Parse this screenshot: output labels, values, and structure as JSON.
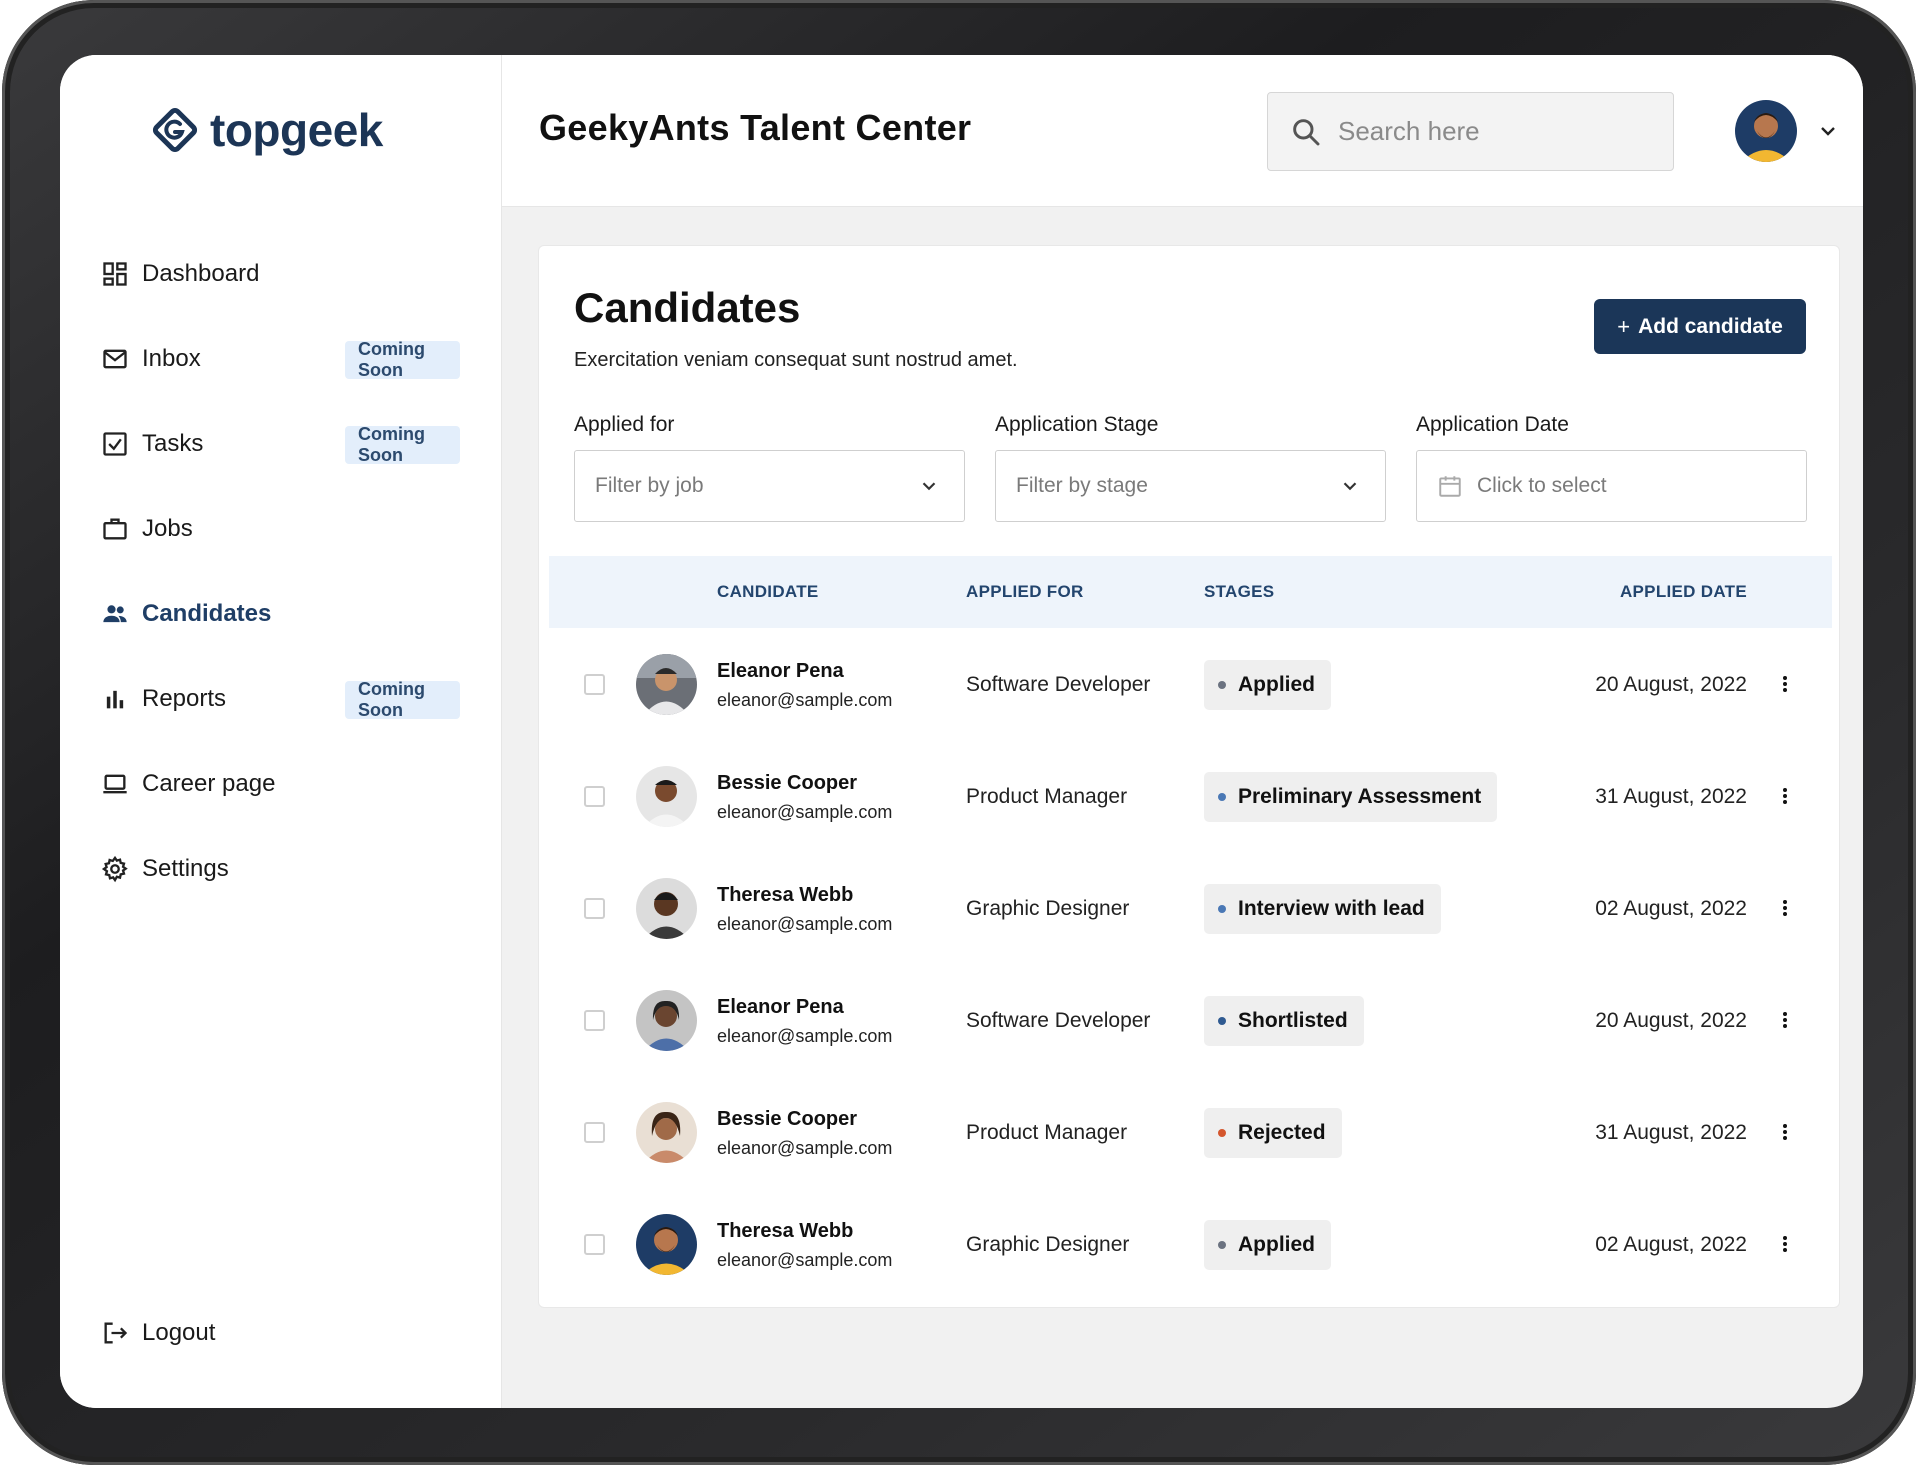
{
  "brand": {
    "name": "topgeek",
    "color": "#1c3556"
  },
  "sidebar": {
    "items": [
      {
        "label": "Dashboard",
        "icon": "dashboard-icon",
        "badge": ""
      },
      {
        "label": "Inbox",
        "icon": "mail-icon",
        "badge": "Coming Soon"
      },
      {
        "label": "Tasks",
        "icon": "checkbox-icon",
        "badge": "Coming Soon"
      },
      {
        "label": "Jobs",
        "icon": "briefcase-icon",
        "badge": ""
      },
      {
        "label": "Candidates",
        "icon": "people-icon",
        "badge": "",
        "active": true
      },
      {
        "label": "Reports",
        "icon": "bar-chart-icon",
        "badge": "Coming Soon"
      },
      {
        "label": "Career page",
        "icon": "laptop-icon",
        "badge": ""
      },
      {
        "label": "Settings",
        "icon": "gear-icon",
        "badge": ""
      }
    ],
    "logout": {
      "label": "Logout",
      "icon": "logout-icon"
    }
  },
  "header": {
    "title": "GeekyAnts Talent Center",
    "search_placeholder": "Search here"
  },
  "page": {
    "title": "Candidates",
    "subtitle": "Exercitation veniam consequat sunt nostrud amet.",
    "add_button": "Add candidate",
    "accent": "#1b3658"
  },
  "filters": [
    {
      "label": "Applied for",
      "placeholder": "Filter by job"
    },
    {
      "label": "Application Stage",
      "placeholder": "Filter by stage"
    },
    {
      "label": "Application Date",
      "placeholder": "Click to select"
    }
  ],
  "table": {
    "headers": [
      "CANDIDATE",
      "APPLIED FOR",
      "STAGES",
      "APPLIED DATE"
    ],
    "rows": [
      {
        "name": "Eleanor Pena",
        "email": "eleanor@sample.com",
        "job": "Software Developer",
        "stage": "Applied",
        "stage_color": "#6b7280",
        "date": "20 August, 2022"
      },
      {
        "name": "Bessie Cooper",
        "email": "eleanor@sample.com",
        "job": "Product Manager",
        "stage": "Preliminary Assessment",
        "stage_color": "#4a78b5",
        "date": "31 August, 2022"
      },
      {
        "name": "Theresa Webb",
        "email": "eleanor@sample.com",
        "job": "Graphic Designer",
        "stage": "Interview with lead",
        "stage_color": "#4a78b5",
        "date": "02 August, 2022"
      },
      {
        "name": "Eleanor Pena",
        "email": "eleanor@sample.com",
        "job": "Software Developer",
        "stage": "Shortlisted",
        "stage_color": "#2f5a91",
        "date": "20 August, 2022"
      },
      {
        "name": "Bessie Cooper",
        "email": "eleanor@sample.com",
        "job": "Product Manager",
        "stage": "Rejected",
        "stage_color": "#d4562d",
        "date": "31 August, 2022"
      },
      {
        "name": "Theresa Webb",
        "email": "eleanor@sample.com",
        "job": "Graphic Designer",
        "stage": "Applied",
        "stage_color": "#6b7280",
        "date": "02 August, 2022"
      }
    ]
  }
}
